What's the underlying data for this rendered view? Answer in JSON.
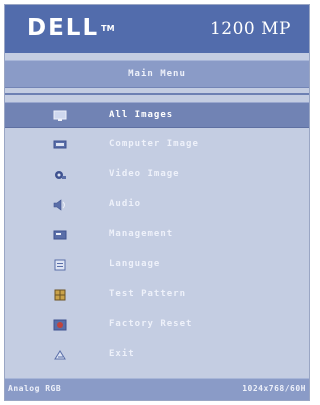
{
  "brand": {
    "logo": "DELL",
    "trademark": "TM"
  },
  "header": {
    "model": "1200 MP"
  },
  "menu": {
    "title": "Main Menu",
    "items": [
      {
        "label": "All Images",
        "icon": "monitor-icon",
        "selected": true
      },
      {
        "label": "Computer Image",
        "icon": "computer-icon",
        "selected": false
      },
      {
        "label": "Video Image",
        "icon": "video-icon",
        "selected": false
      },
      {
        "label": "Audio",
        "icon": "speaker-icon",
        "selected": false
      },
      {
        "label": "Management",
        "icon": "management-icon",
        "selected": false
      },
      {
        "label": "Language",
        "icon": "language-icon",
        "selected": false
      },
      {
        "label": "Test Pattern",
        "icon": "test-pattern-icon",
        "selected": false
      },
      {
        "label": "Factory Reset",
        "icon": "factory-reset-icon",
        "selected": false
      },
      {
        "label": "Exit",
        "icon": "exit-icon",
        "selected": false
      }
    ]
  },
  "status": {
    "source": "Analog RGB",
    "resolution": "1024x768/60H"
  },
  "colors": {
    "header_bg": "#526cac",
    "panel_bg": "#c4cde2",
    "bar_bg": "#8a9bc7",
    "selected_bg": "#7183b4",
    "text": "#eef1fa"
  }
}
